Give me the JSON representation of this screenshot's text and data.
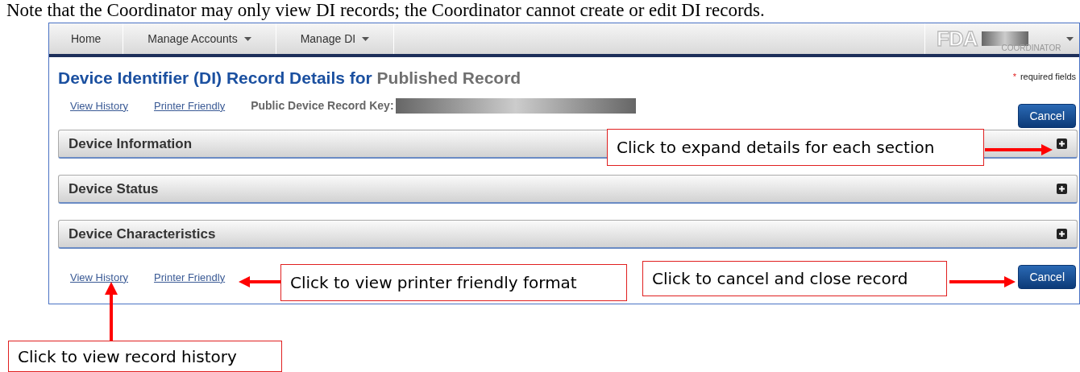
{
  "doc_note": "Note that the Coordinator may only view DI records; the Coordinator cannot create or edit DI records.",
  "nav": {
    "items": [
      {
        "label": "Home",
        "has_menu": false
      },
      {
        "label": "Manage Accounts",
        "has_menu": true
      },
      {
        "label": "Manage DI",
        "has_menu": true
      }
    ],
    "logo": "FDA",
    "role": "COORDINATOR"
  },
  "title": {
    "main": "Device Identifier (DI) Record Details for",
    "status": "Published Record"
  },
  "required": {
    "mark": "*",
    "label": "required fields"
  },
  "top_links": [
    "View History",
    "Printer Friendly"
  ],
  "key_label": "Public Device Record Key:",
  "cancel_top": "Cancel",
  "sections": [
    {
      "title": "Device Information",
      "expanded": false
    },
    {
      "title": "Device Status",
      "expanded": false
    },
    {
      "title": "Device Characteristics",
      "expanded": false
    }
  ],
  "bottom_links": [
    "View History",
    "Printer Friendly"
  ],
  "cancel_bottom": "Cancel",
  "callouts": [
    {
      "text": "Click to expand details for each section"
    },
    {
      "text": "Click to view printer friendly format"
    },
    {
      "text": "Click to cancel and close record"
    },
    {
      "text": "Click to view record history"
    }
  ]
}
